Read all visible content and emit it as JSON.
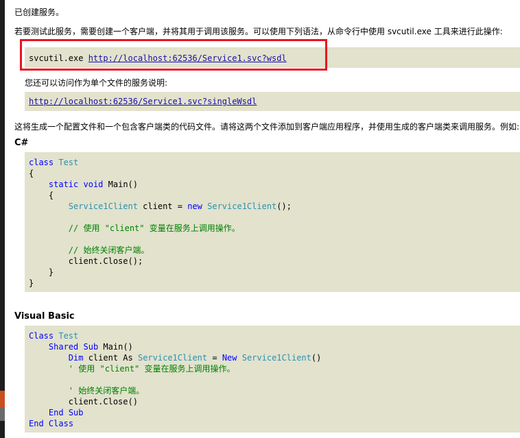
{
  "intro": {
    "created": "已创建服务。",
    "instruction_prefix": "若要测试此服务，需要创建一个客户端，并将其用于调用该服务。可以使用下列语法，从命令行中使用",
    "tool": " svcutil.exe ",
    "instruction_suffix": "工具来进行此操作:"
  },
  "svcutil": {
    "command": "svcutil.exe ",
    "url": "http://localhost:62536/Service1.svc?wsdl"
  },
  "single_file": {
    "text": "您还可以访问作为单个文件的服务说明:",
    "url": "http://localhost:62536/Service1.svc?singleWsdl"
  },
  "generate_text": "这将生成一个配置文件和一个包含客户端类的代码文件。请将这两个文件添加到客户端应用程序，并使用生成的客户端类来调用服务。例如:",
  "csharp": {
    "heading": "C#",
    "kw_class": "class",
    "class_name": "Test",
    "brace_open": "{",
    "brace_close": "}",
    "kw_static": "static",
    "kw_void": "void",
    "method": "Main()",
    "type_client": "Service1Client",
    "var_decl": " client = ",
    "kw_new": "new",
    "call_end": "();",
    "comment1": "// 使用 \"client\" 变量在服务上调用操作。",
    "comment2": "// 始终关闭客户端。",
    "close_call": "client.Close();"
  },
  "vb": {
    "heading": "Visual Basic",
    "kw_class": "Class",
    "class_name": "Test",
    "kw_shared": "Shared",
    "kw_sub": "Sub",
    "method": "Main()",
    "kw_dim": "Dim",
    "client_as": " client As ",
    "type_client": "Service1Client",
    "equals": " = ",
    "kw_new": "New",
    "call_end": "()",
    "comment1": "' 使用 \"client\" 变量在服务上调用操作。",
    "comment2": "' 始终关闭客户端。",
    "close_call": "client.Close()",
    "kw_end": "End"
  }
}
